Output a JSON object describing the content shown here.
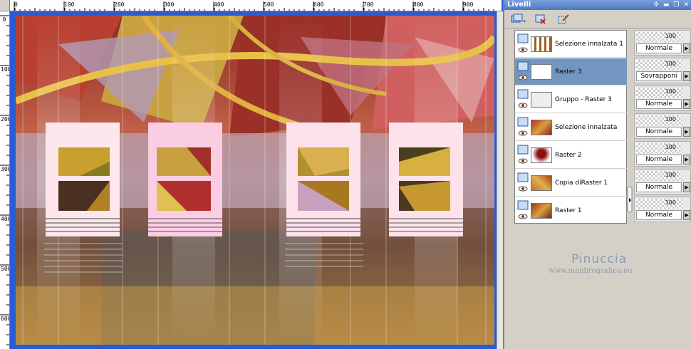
{
  "ruler": {
    "top_labels": [
      "0",
      "100",
      "200",
      "300",
      "400",
      "500",
      "600",
      "700",
      "800",
      "900"
    ],
    "left_labels": [
      "0",
      "100",
      "200",
      "300",
      "400",
      "500",
      "600"
    ]
  },
  "panel": {
    "title": "Livelli",
    "title_buttons": [
      "✣",
      "▬",
      "❐",
      "✕"
    ]
  },
  "layers": [
    {
      "name": "Selezione innalzata 1",
      "opacity": "100",
      "blend": "Normale",
      "selected": false
    },
    {
      "name": "Raster 3",
      "opacity": "100",
      "blend": "Sovrapponi",
      "selected": true
    },
    {
      "name": "Gruppo - Raster 3",
      "opacity": "100",
      "blend": "Normale",
      "selected": false
    },
    {
      "name": "Selezione innalzata",
      "opacity": "100",
      "blend": "Normale",
      "selected": false
    },
    {
      "name": "Raster 2",
      "opacity": "100",
      "blend": "Normale",
      "selected": false
    },
    {
      "name": "Copia diRaster 1",
      "opacity": "100",
      "blend": "Normale",
      "selected": false
    },
    {
      "name": "Raster 1",
      "opacity": "100",
      "blend": "Normale",
      "selected": false
    }
  ],
  "watermark": {
    "name": "Pinuccia",
    "url": "www.maidiregrafica.eu"
  },
  "colors": {
    "selected_row": "#7396c0",
    "title_bar": "#4a78c0",
    "workspace": "#2a5bd7"
  }
}
